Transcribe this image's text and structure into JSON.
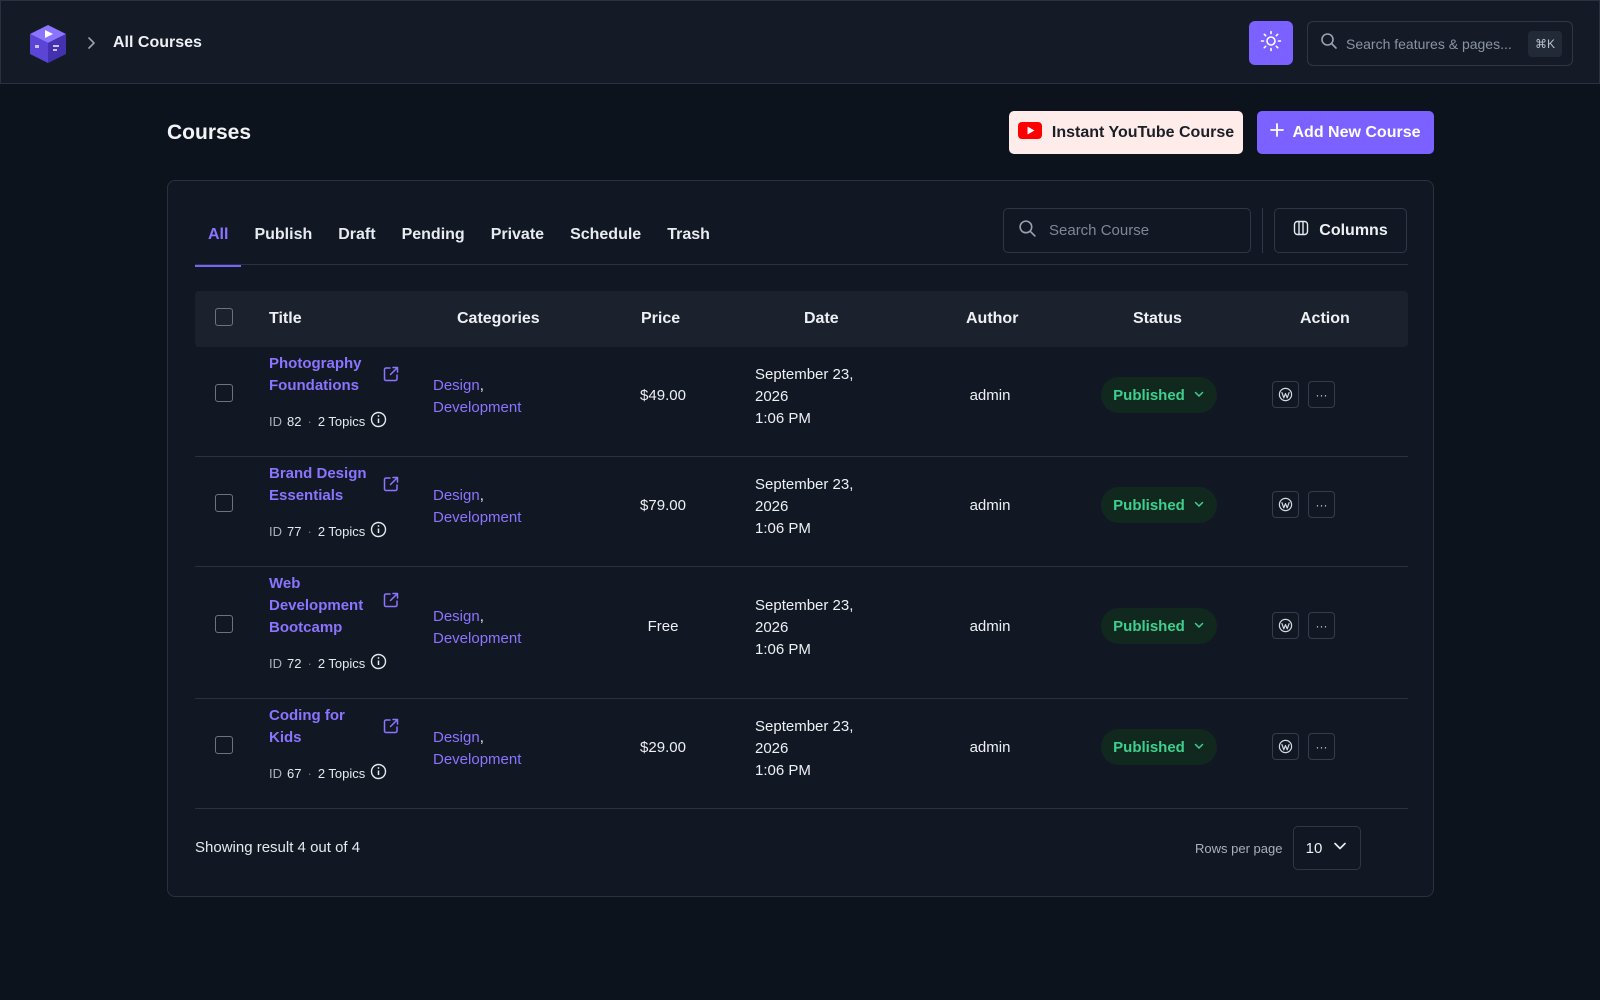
{
  "header": {
    "breadcrumb": "All Courses",
    "search_placeholder": "Search features & pages...",
    "search_shortcut": "⌘K"
  },
  "page": {
    "title": "Courses",
    "youtube_button": "Instant YouTube Course",
    "add_button": "Add New Course"
  },
  "tabs": [
    "All",
    "Publish",
    "Draft",
    "Pending",
    "Private",
    "Schedule",
    "Trash"
  ],
  "active_tab": "All",
  "toolbar": {
    "search_placeholder": "Search Course",
    "columns_label": "Columns"
  },
  "table": {
    "headers": {
      "title": "Title",
      "categories": "Categories",
      "price": "Price",
      "date": "Date",
      "author": "Author",
      "status": "Status",
      "action": "Action"
    },
    "rows": [
      {
        "title_lines": [
          "Photography",
          "Foundations"
        ],
        "id_label": "ID",
        "id": "82",
        "topics": "2 Topics",
        "categories": [
          "Design",
          "Development"
        ],
        "price": "$49.00",
        "date_lines": [
          "September 23,",
          "2026",
          "1:06 PM"
        ],
        "author": "admin",
        "status": "Published"
      },
      {
        "title_lines": [
          "Brand Design",
          "Essentials"
        ],
        "id_label": "ID",
        "id": "77",
        "topics": "2 Topics",
        "categories": [
          "Design",
          "Development"
        ],
        "price": "$79.00",
        "date_lines": [
          "September 23,",
          "2026",
          "1:06 PM"
        ],
        "author": "admin",
        "status": "Published"
      },
      {
        "title_lines": [
          "Web",
          "Development",
          "Bootcamp"
        ],
        "id_label": "ID",
        "id": "72",
        "topics": "2 Topics",
        "categories": [
          "Design",
          "Development"
        ],
        "price": "Free",
        "date_lines": [
          "September 23,",
          "2026",
          "1:06 PM"
        ],
        "author": "admin",
        "status": "Published"
      },
      {
        "title_lines": [
          "Coding for",
          "Kids"
        ],
        "id_label": "ID",
        "id": "67",
        "topics": "2 Topics",
        "categories": [
          "Design",
          "Development"
        ],
        "price": "$29.00",
        "date_lines": [
          "September 23,",
          "2026",
          "1:06 PM"
        ],
        "author": "admin",
        "status": "Published"
      }
    ]
  },
  "footer": {
    "showing": "Showing result 4 out of 4",
    "rows_per_page_label": "Rows per page",
    "rows_per_page_value": "10"
  },
  "colors": {
    "accent": "#7b61ff",
    "published": "#3ecf8e",
    "youtube_red": "#ff0000"
  }
}
